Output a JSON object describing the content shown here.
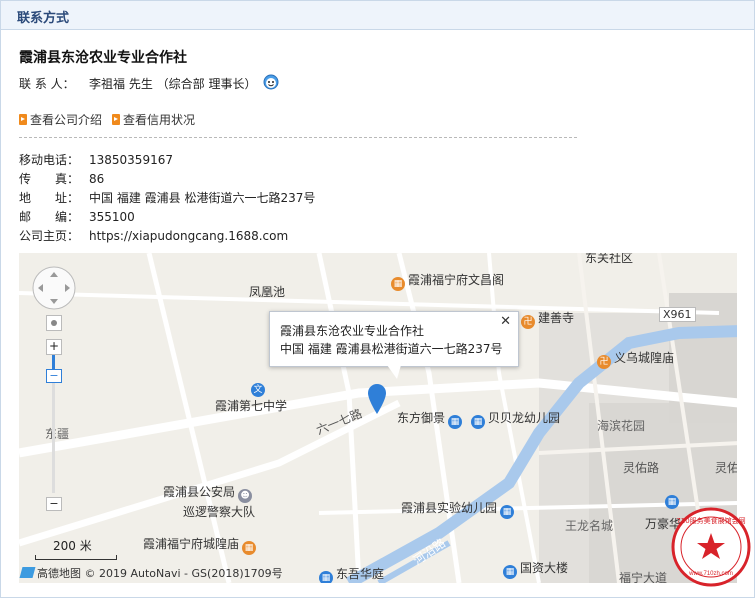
{
  "panel": {
    "title": "联系方式"
  },
  "company": {
    "name": "霞浦县东沧农业专业合作社"
  },
  "contact": {
    "label": "联 系 人：",
    "value": "李祖福 先生 （综合部 理事长）"
  },
  "links": [
    {
      "label": "查看公司介绍"
    },
    {
      "label": "查看信用状况"
    }
  ],
  "info": [
    {
      "label": "移动电话：",
      "value": "13850359167"
    },
    {
      "label": "传　　真：",
      "value": "86"
    },
    {
      "label": "地　　址：",
      "value": "中国 福建 霞浦县 松港街道六一七路237号"
    },
    {
      "label": "邮　　编：",
      "value": "355100"
    },
    {
      "label": "公司主页：",
      "value": "https://xiapudongcang.1688.com"
    }
  ],
  "map": {
    "bubble": {
      "line1": "霞浦县东沧农业专业合作社",
      "line2": "中国 福建 霞浦县松港街道六一七路237号",
      "close": "✕"
    },
    "pois": [
      {
        "label": "东关社区"
      },
      {
        "label": "凤凰池"
      },
      {
        "label": "霞浦福宁府文昌阁"
      },
      {
        "label": "建善寺"
      },
      {
        "label": "X961"
      },
      {
        "label": "义乌城隍庙"
      },
      {
        "label": "霞浦第七中学"
      },
      {
        "label": "东方御景"
      },
      {
        "label": "贝贝龙幼儿园"
      },
      {
        "label": "海滨花园"
      },
      {
        "label": "六一七路"
      },
      {
        "label": "东疆"
      },
      {
        "label": "灵佑路"
      },
      {
        "label": "灵佑"
      },
      {
        "label": "霞浦县公安局"
      },
      {
        "label": "巡逻警察大队"
      },
      {
        "label": "霞浦县实验幼儿园"
      },
      {
        "label": "王龙名城"
      },
      {
        "label": "万豪华庭"
      },
      {
        "label": "霞浦福宁府城隍庙"
      },
      {
        "label": "河沿路"
      },
      {
        "label": "东吾华庭"
      },
      {
        "label": "国资大楼"
      },
      {
        "label": "福宁大道"
      }
    ],
    "scale": "200 米",
    "copyright": "高德地图 © 2019 AutoNavi - GS(2018)1709号",
    "zoom_plus": "+",
    "zoom_minus": "−",
    "zoom_minus_bottom": "−"
  },
  "stamp": {
    "text": "710服务美食展馆会网",
    "site": "www.710zh.com"
  },
  "colors": {
    "accent": "#2b4a7a",
    "header_bg": "#eef4fb",
    "river": "#a9c9ec",
    "marker": "#2f7fd8",
    "stamp": "#d8232a"
  }
}
